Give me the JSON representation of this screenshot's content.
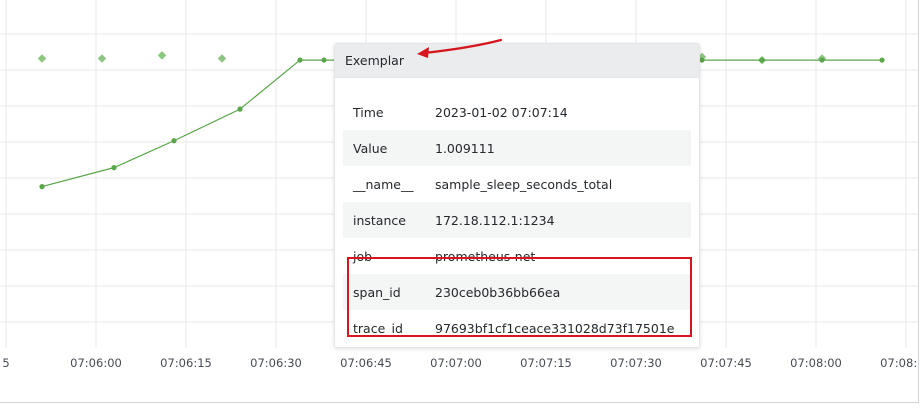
{
  "chart_data": {
    "type": "line",
    "x_ticks": [
      "5",
      "07:06:00",
      "07:06:15",
      "07:06:30",
      "07:06:45",
      "07:07:00",
      "07:07:15",
      "07:07:30",
      "07:07:45",
      "07:08:00",
      "07:08:15"
    ],
    "x_tick_seconds": [
      345,
      360,
      375,
      390,
      405,
      420,
      435,
      450,
      465,
      480,
      495
    ],
    "series": [
      {
        "kind": "line",
        "color": "#5aa64b",
        "x": [
          351,
          363,
          373,
          384,
          394,
          398,
          411,
          421,
          431,
          441,
          451,
          461,
          471,
          481,
          491
        ],
        "y": [
          0.817,
          0.829,
          0.846,
          0.866,
          0.897,
          0.897,
          0.897,
          0.897,
          0.897,
          0.897,
          0.897,
          0.897,
          0.897,
          0.897,
          0.897
        ]
      },
      {
        "kind": "exemplars",
        "color": "#8bc77f",
        "x": [
          351,
          361,
          371,
          381,
          401,
          411,
          421,
          431,
          436,
          451,
          461,
          471,
          481
        ],
        "y": [
          0.898,
          0.898,
          0.9,
          0.898,
          0.898,
          0.9,
          0.898,
          0.898,
          0.899,
          0.899,
          0.899,
          0.897,
          0.898
        ]
      }
    ],
    "ylim": [
      0.72,
      0.935
    ],
    "xlim": [
      344,
      497
    ]
  },
  "tooltip": {
    "title": "Exemplar",
    "rows": [
      {
        "key": "Time",
        "value": "2023-01-02 07:07:14"
      },
      {
        "key": "Value",
        "value": "1.009111"
      },
      {
        "key": "__name__",
        "value": "sample_sleep_seconds_total"
      },
      {
        "key": "instance",
        "value": "172.18.112.1:1234"
      },
      {
        "key": "job",
        "value": "prometheus-net"
      },
      {
        "key": "span_id",
        "value": "230ceb0b36bb66ea"
      },
      {
        "key": "trace_id",
        "value": "97693bf1cf1ceace331028d73f17501e"
      }
    ]
  },
  "annotation": {
    "color": "#d6161f"
  },
  "selected_exemplar": {
    "x": 434,
    "y": 0.899
  }
}
